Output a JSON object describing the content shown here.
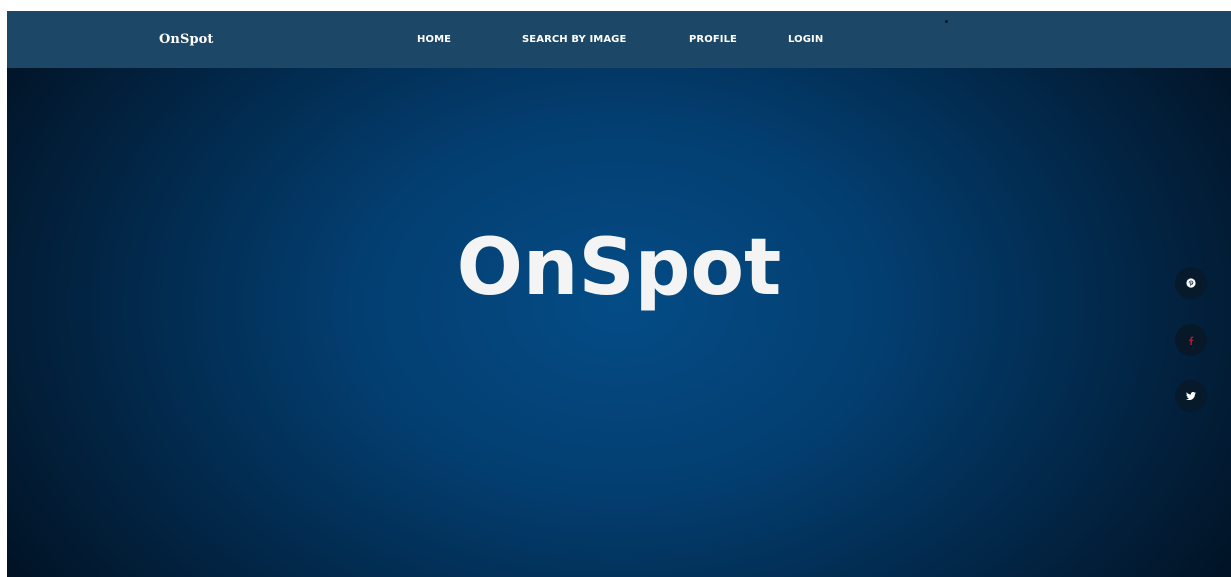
{
  "navbar": {
    "brand": "OnSpot",
    "links": [
      {
        "label": "HOME"
      },
      {
        "label": "SEARCH BY IMAGE"
      },
      {
        "label": "PROFILE"
      },
      {
        "label": "LOGIN"
      }
    ]
  },
  "hero": {
    "title": "OnSpot"
  },
  "social": [
    {
      "icon": "pinterest-icon",
      "color": "#ffffff"
    },
    {
      "icon": "facebook-icon",
      "color": "#b31b2f"
    },
    {
      "icon": "twitter-icon",
      "color": "#ffffff"
    }
  ],
  "colors": {
    "navbar_bg": "#1c4766",
    "hero_center": "#044c86",
    "hero_edge": "#010f1e",
    "text": "#ffffff"
  }
}
